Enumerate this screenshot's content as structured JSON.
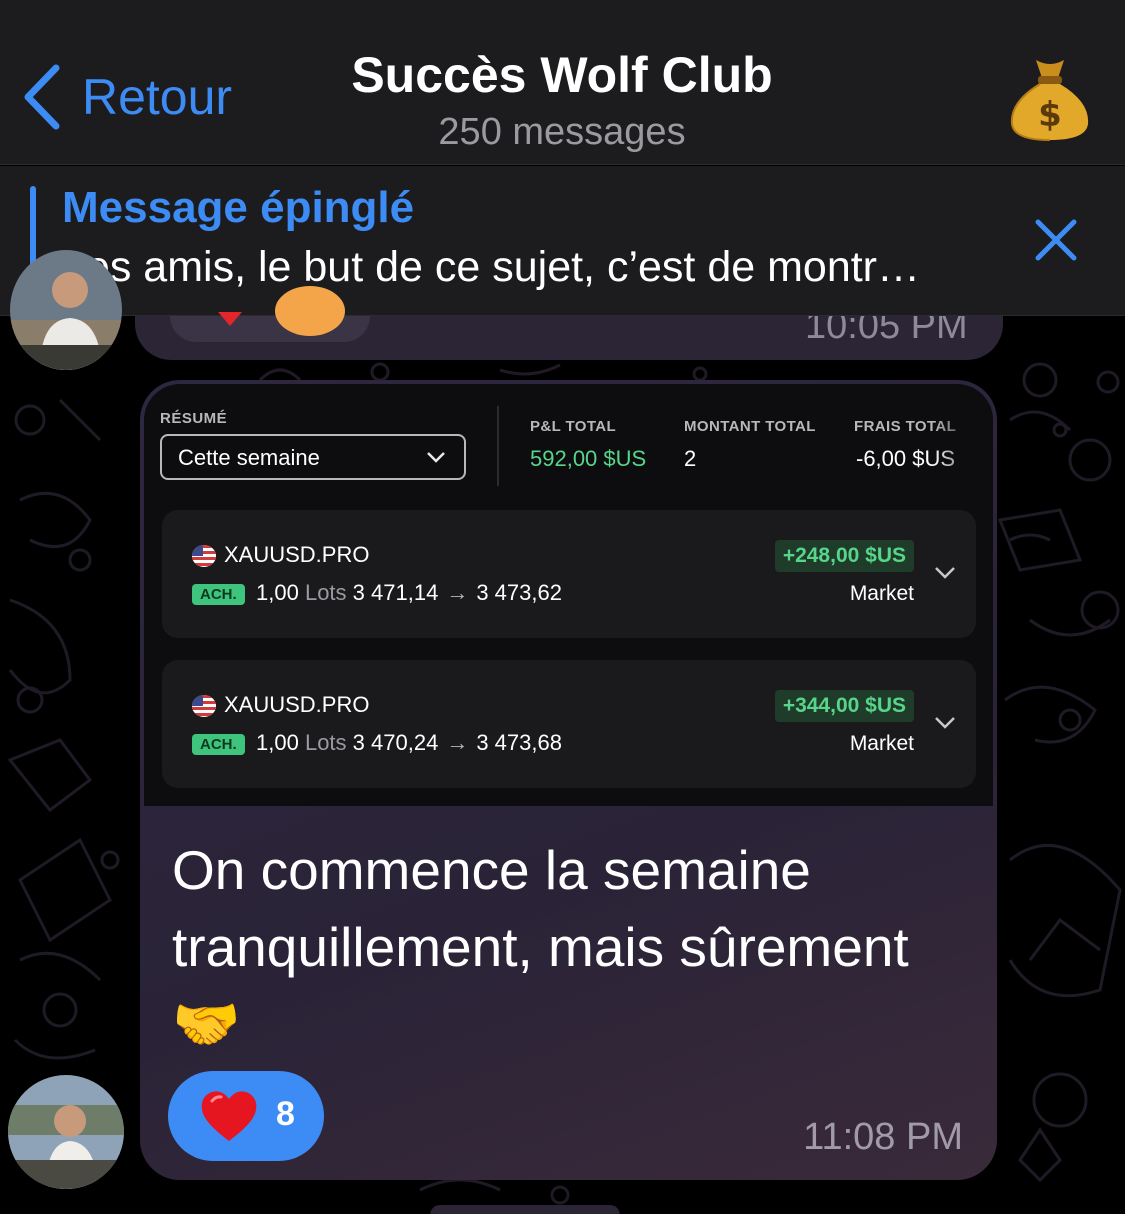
{
  "header": {
    "back_label": "Retour",
    "title": "Succès Wolf Club",
    "subtitle": "250 messages",
    "avatar_icon": "money-bag-icon"
  },
  "pinned": {
    "title": "Message épinglé",
    "text": "Les amis, le but de ce sujet, c’est de montr…"
  },
  "previous_message": {
    "time": "10:05 PM"
  },
  "message": {
    "screenshot": {
      "summary_label": "RÉSUMÉ",
      "period_value": "Cette semaine",
      "stats": [
        {
          "label": "P&L TOTAL",
          "value": "592,00 $US",
          "color": "#57d58a"
        },
        {
          "label": "MONTANT TOTAL",
          "value": "2",
          "color": "#ffffff"
        },
        {
          "label": "FRAIS TOTAL",
          "value": "-6,00 $US",
          "color": "#ffffff"
        }
      ],
      "trades": [
        {
          "symbol": "XAUUSD.PRO",
          "side": "ACH.",
          "lots": "1,00",
          "lots_unit": "Lots",
          "open": "3 471,14",
          "close": "3 473,62",
          "pnl": "+248,00 $US",
          "type": "Market"
        },
        {
          "symbol": "XAUUSD.PRO",
          "side": "ACH.",
          "lots": "1,00",
          "lots_unit": "Lots",
          "open": "3 470,24",
          "close": "3 473,68",
          "pnl": "+344,00 $US",
          "type": "Market"
        }
      ]
    },
    "text": "On commence la semaine tranquillement, mais sûrement 🤝",
    "reaction": {
      "icon": "heart-icon",
      "count": "8"
    },
    "time": "11:08 PM"
  },
  "colors": {
    "accent": "#3d8cf5",
    "bubble": "#2e2740",
    "profit": "#57d58a"
  }
}
